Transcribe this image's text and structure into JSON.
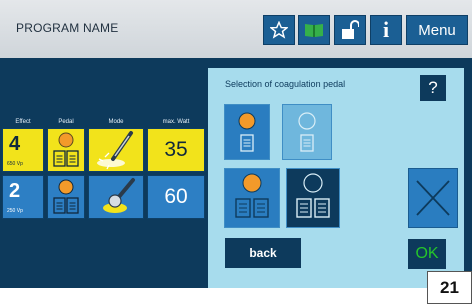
{
  "header": {
    "program_name": "PROGRAM NAME",
    "menu_label": "Menu",
    "icons": [
      "star-icon",
      "book-icon",
      "unlock-icon",
      "info-icon"
    ]
  },
  "table": {
    "headers": [
      "Effect",
      "Pedal",
      "Mode",
      "max. Watt"
    ],
    "rows": [
      {
        "effect": "4",
        "vp": "650 Vp",
        "watt": "35",
        "highlight": "yellow"
      },
      {
        "effect": "2",
        "vp": "250 Vp",
        "watt": "60",
        "highlight": "blue"
      }
    ]
  },
  "dialog": {
    "title": "Selection of coagulation pedal",
    "help": "?",
    "back": "back",
    "ok": "OK"
  },
  "figure_number": "21",
  "colors": {
    "background": "#0d3a5c",
    "panel": "#a7dced",
    "accent_yellow": "#f2e31b",
    "accent_blue": "#2d7fc4",
    "pedal_orange": "#f39a2a",
    "ok_green": "#25c52a"
  }
}
